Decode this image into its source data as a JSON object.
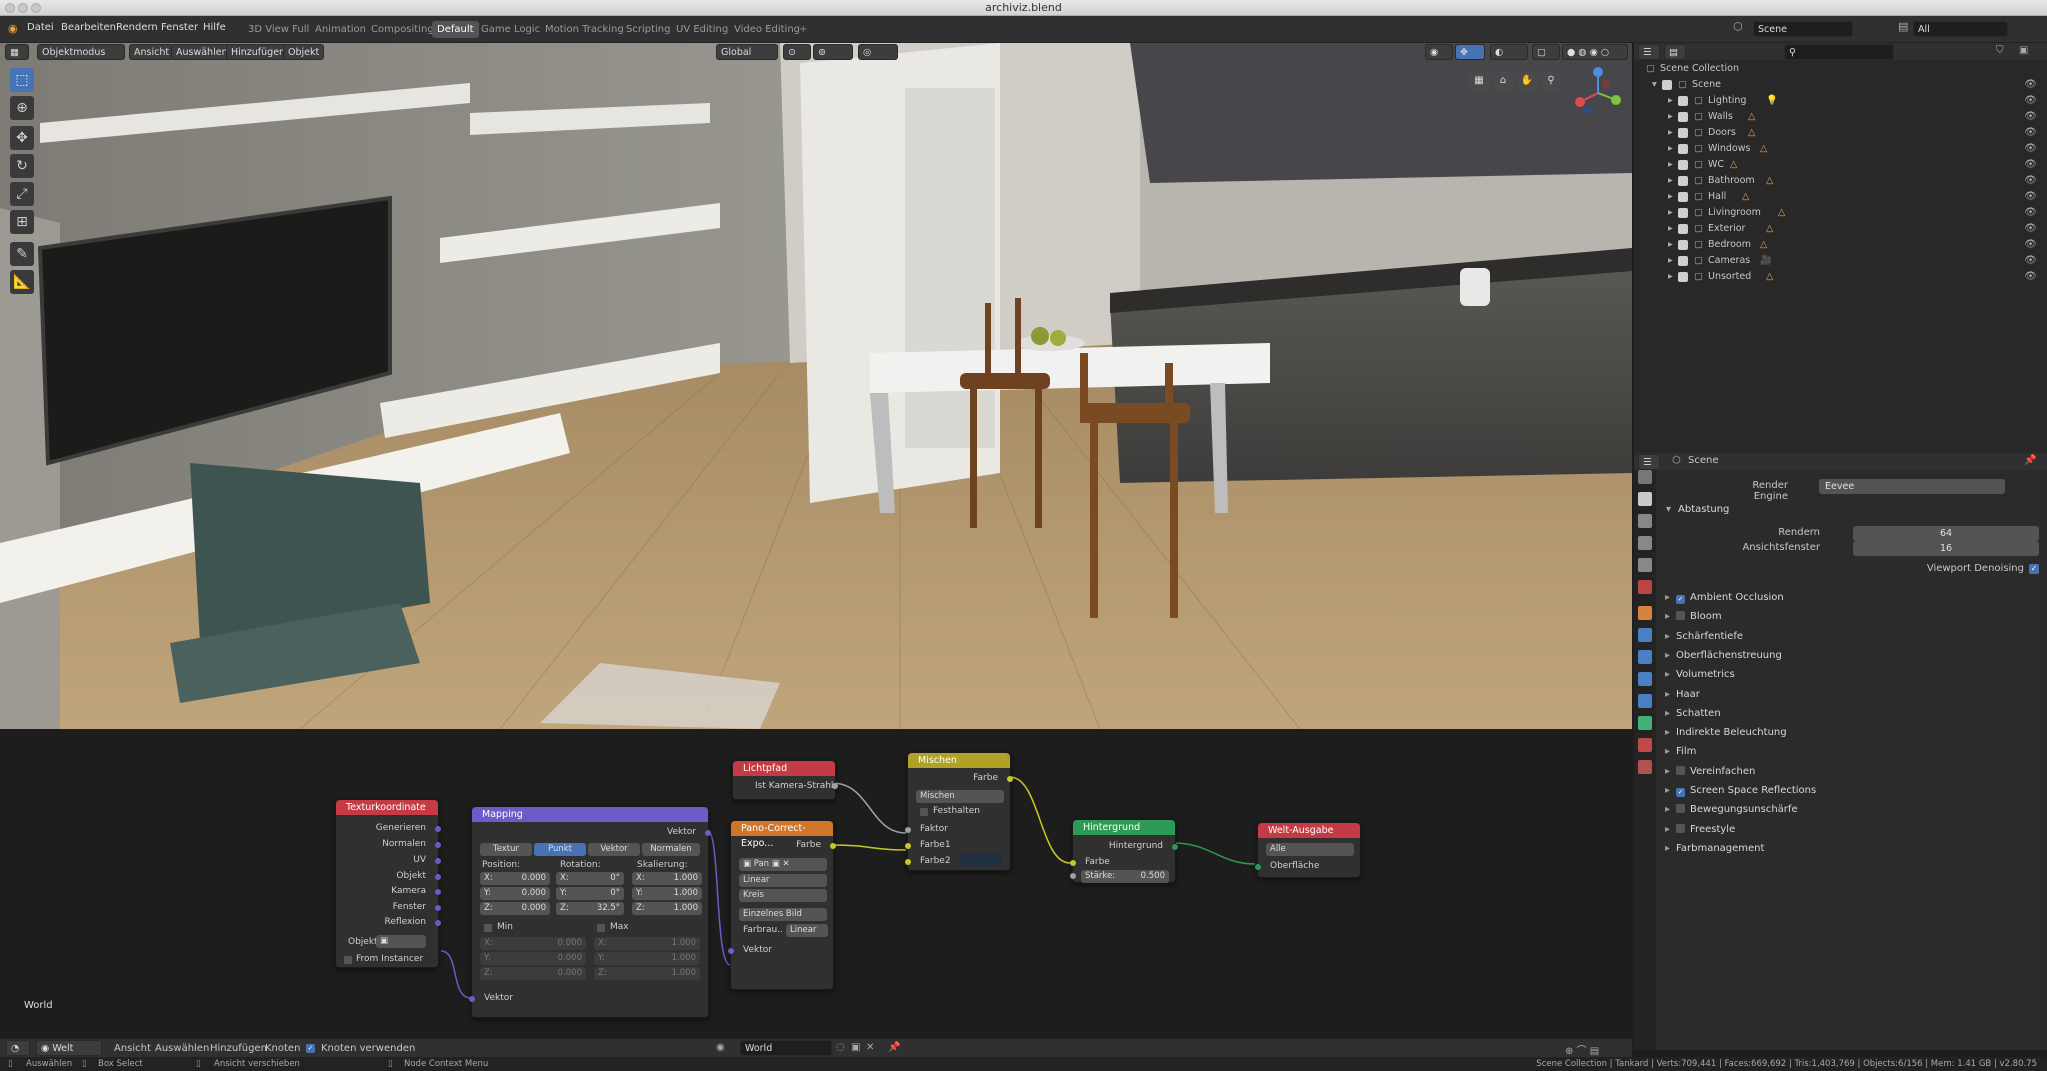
{
  "window": {
    "title": "archiviz.blend"
  },
  "menu": [
    "Datei",
    "Bearbeiten",
    "Rendern",
    "Fenster",
    "Hilfe"
  ],
  "workspaces": [
    "3D View Full",
    "Animation",
    "Compositing",
    "Default",
    "Game Logic",
    "Motion Tracking",
    "Scripting",
    "UV Editing",
    "Video Editing"
  ],
  "active_workspace": "Default",
  "scene_field": "Scene",
  "viewlayer_field": "All",
  "viewport_header": {
    "mode": "Objektmodus",
    "view": "Ansicht",
    "select": "Auswählen",
    "add": "Hinzufügen",
    "object": "Objekt",
    "transform": "Global"
  },
  "outliner": {
    "root": "Scene Collection",
    "scene": "Scene",
    "items": [
      "Lighting",
      "Walls",
      "Doors",
      "Windows",
      "WC",
      "Bathroom",
      "Hall",
      "Livingroom",
      "Exterior",
      "Bedroom",
      "Cameras",
      "Unsorted"
    ]
  },
  "properties": {
    "context": "Scene",
    "render_engine_label": "Render Engine",
    "render_engine": "Eevee",
    "sampling": "Abtastung",
    "render_label": "Rendern",
    "render_value": "64",
    "viewport_label": "Ansichtsfenster",
    "viewport_value": "16",
    "denoise_label": "Viewport Denoising",
    "sections": [
      {
        "label": "Ambient Occlusion",
        "checked": true
      },
      {
        "label": "Bloom",
        "checked": false
      },
      {
        "label": "Schärfentiefe"
      },
      {
        "label": "Oberflächenstreuung"
      },
      {
        "label": "Volumetrics"
      },
      {
        "label": "Haar"
      },
      {
        "label": "Schatten"
      },
      {
        "label": "Indirekte Beleuchtung"
      },
      {
        "label": "Film"
      },
      {
        "label": "Vereinfachen",
        "checked": false
      },
      {
        "label": "Screen Space Reflections",
        "checked": true
      },
      {
        "label": "Bewegungsunschärfe",
        "checked": false
      },
      {
        "label": "Freestyle",
        "checked": false
      },
      {
        "label": "Farbmanagement"
      }
    ]
  },
  "nodes": {
    "texcoord": {
      "title": "Texturkoordinate",
      "outputs": [
        "Generieren",
        "Normalen",
        "UV",
        "Objekt",
        "Kamera",
        "Fenster",
        "Reflexion"
      ],
      "object_label": "Objekt",
      "instancer": "From Instancer"
    },
    "mapping": {
      "title": "Mapping",
      "output": "Vektor",
      "tabs": [
        "Textur",
        "Punkt",
        "Vektor",
        "Normalen"
      ],
      "active_tab": "Punkt",
      "headers": [
        "Position:",
        "Rotation:",
        "Skalierung:"
      ],
      "rows": [
        {
          "axis": [
            "X:",
            "X:",
            "X:"
          ],
          "values": [
            "0.000",
            "0°",
            "1.000"
          ]
        },
        {
          "axis": [
            "Y:",
            "Y:",
            "Y:"
          ],
          "values": [
            "0.000",
            "0°",
            "1.000"
          ]
        },
        {
          "axis": [
            "Z:",
            "Z:",
            "Z:"
          ],
          "values": [
            "0.000",
            "32.5°",
            "1.000"
          ]
        }
      ],
      "min_label": "Min",
      "max_label": "Max",
      "min_rows": [
        [
          "X:",
          "0.000"
        ],
        [
          "Y:",
          "0.000"
        ],
        [
          "Z:",
          "0.000"
        ]
      ],
      "max_rows": [
        [
          "X:",
          "1.000"
        ],
        [
          "Y:",
          "1.000"
        ],
        [
          "Z:",
          "1.000"
        ]
      ],
      "input": "Vektor"
    },
    "lightpath": {
      "title": "Lichtpfad",
      "output": "Ist Kamera-Strahl"
    },
    "pano": {
      "title": "Pano-Correct-Expo...",
      "output": "Farbe",
      "image": "Pan",
      "interp": "Linear",
      "proj": "Kreis",
      "source": "Einzelnes Bild",
      "colorspace_label": "Farbrau..",
      "colorspace": "Linear",
      "input": "Vektor"
    },
    "mix": {
      "title": "Mischen",
      "output": "Farbe",
      "blend": "Mischen",
      "clamp": "Festhalten",
      "inputs": [
        "Faktor",
        "Farbe1",
        "Farbe2"
      ]
    },
    "background": {
      "title": "Hintergrund",
      "output": "Hintergrund",
      "color": "Farbe",
      "strength_label": "Stärke:",
      "strength": "0.500"
    },
    "world_output": {
      "title": "Welt-Ausgabe",
      "target": "Alle",
      "input": "Oberfläche"
    }
  },
  "node_editor": {
    "label": "World",
    "world_mode": "Welt",
    "view": "Ansicht",
    "select": "Auswählen",
    "add": "Hinzufügen",
    "node": "Knoten",
    "use_nodes": "Knoten verwenden",
    "world_name": "World"
  },
  "statusbar": {
    "select": "Auswählen",
    "box": "Box Select",
    "move": "Ansicht verschieben",
    "context": "Node Context Menu",
    "stats": "Scene Collection | Tankard | Verts:709,441 | Faces:669,692 | Tris:1,403,769 | Objects:6/156 | Mem: 1.41 GB | v2.80.75"
  },
  "colors": {
    "accent": "#4772b3",
    "node_input": "#c43b45",
    "node_vector": "#6c5cc7",
    "node_texture": "#d0752a",
    "node_color": "#b0a228",
    "node_shader": "#2d9a55",
    "node_output": "#c43b45"
  }
}
